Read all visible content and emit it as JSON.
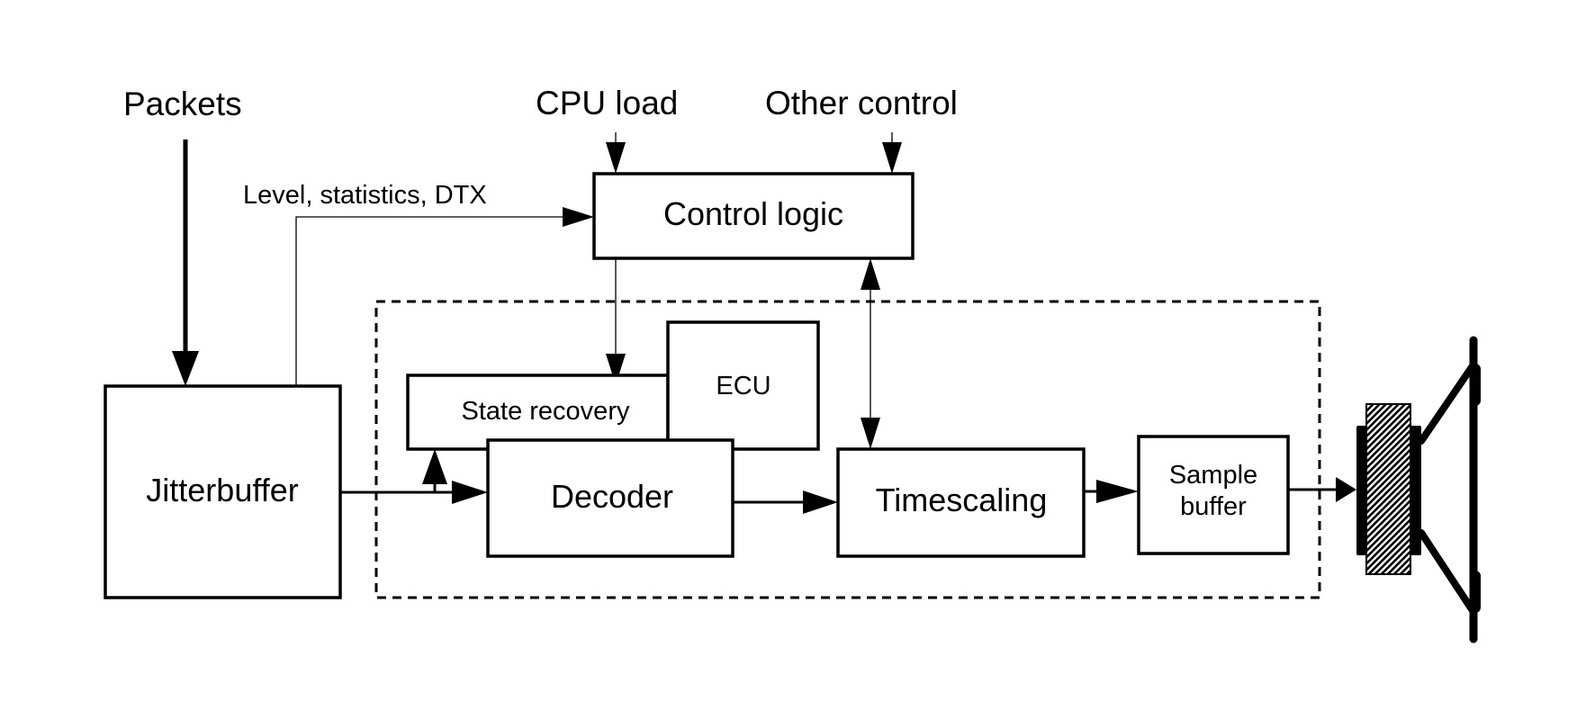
{
  "diagram": {
    "inputs": {
      "packets": "Packets",
      "cpu_load": "CPU load",
      "other_control": "Other control"
    },
    "signals": {
      "level_stats": "Level, statistics, DTX"
    },
    "blocks": {
      "jitterbuffer": "Jitterbuffer",
      "control_logic": "Control logic",
      "state_recovery": "State recovery",
      "ecu": "ECU",
      "decoder": "Decoder",
      "timescaling": "Timescaling",
      "sample_buffer_line1": "Sample",
      "sample_buffer_line2": "buffer"
    },
    "output_device": "speaker-icon",
    "colors": {
      "stroke": "#000000",
      "background": "#ffffff"
    }
  }
}
